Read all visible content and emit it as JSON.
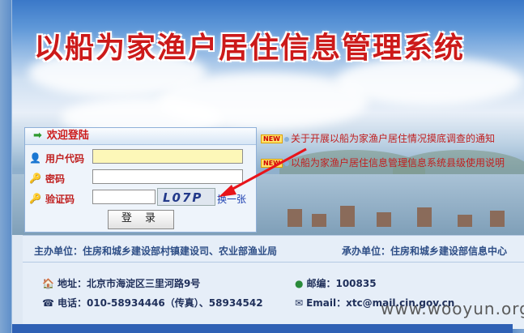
{
  "title": "以船为家渔户居住信息管理系统",
  "news": [
    {
      "tag": "NEW",
      "text": "关于开展以船为家渔户居住情况摸底调查的通知"
    },
    {
      "tag": "NEW",
      "text": "以船为家渔户居住信息管理信息系统县级使用说明"
    }
  ],
  "login": {
    "heading": "欢迎登陆",
    "user_label": "用户代码",
    "password_label": "密码",
    "captcha_label": "验证码",
    "captcha_text": "L07P",
    "swap_link": "换一张",
    "submit_label": "登 录"
  },
  "footer": {
    "sponsor": "主办单位：住房和城乡建设部村镇建设司、农业部渔业局",
    "organizer": "承办单位：住房和城乡建设部信息中心",
    "address": "地址：北京市海淀区三里河路9号",
    "postcode": "邮编：100835",
    "phone": "电话：010-58934446（传真）、58934542",
    "email": "Email：xtc@mail.cin.gov.cn"
  },
  "watermark": "www.wooyun.org",
  "colors": {
    "title": "#cc1a1a",
    "accent": "#2f61b5"
  }
}
